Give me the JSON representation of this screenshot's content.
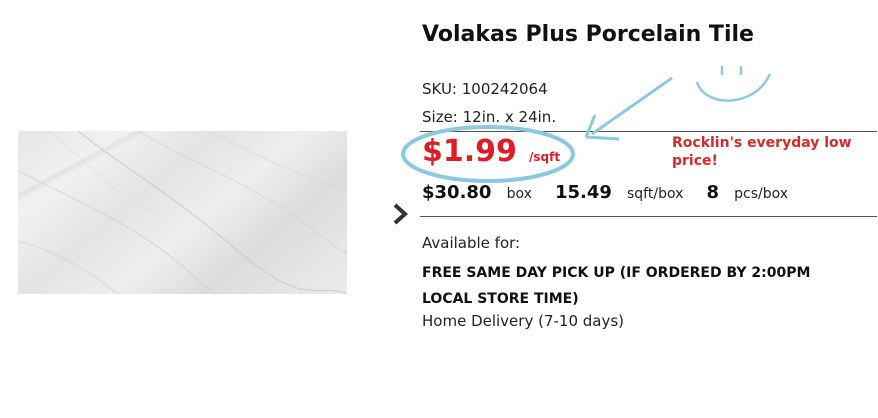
{
  "product": {
    "title": "Volakas Plus Porcelain Tile",
    "sku_label": "SKU: 100242064",
    "size_label": "Size: 12in. x 24in.",
    "price": "$1.99",
    "price_unit": "/sqft",
    "box_price": "$30.80",
    "box_price_unit": "box",
    "sqft_per_box": "15.49",
    "sqft_per_box_unit": "sqft/box",
    "pcs_per_box": "8",
    "pcs_per_box_unit": "pcs/box"
  },
  "availability": {
    "label": "Available for:",
    "pickup": "FREE SAME DAY PICK UP (IF ORDERED BY 2:00PM LOCAL STORE TIME)",
    "delivery": "Home Delivery (7-10 days)"
  },
  "annotation": {
    "text": "Rocklin's everyday low price!"
  },
  "icons": {
    "next_arrow": "chevron-right-icon"
  },
  "colors": {
    "price_red": "#e01b24",
    "annotation_red": "#d42a2a",
    "markup_blue": "#86c8de"
  }
}
